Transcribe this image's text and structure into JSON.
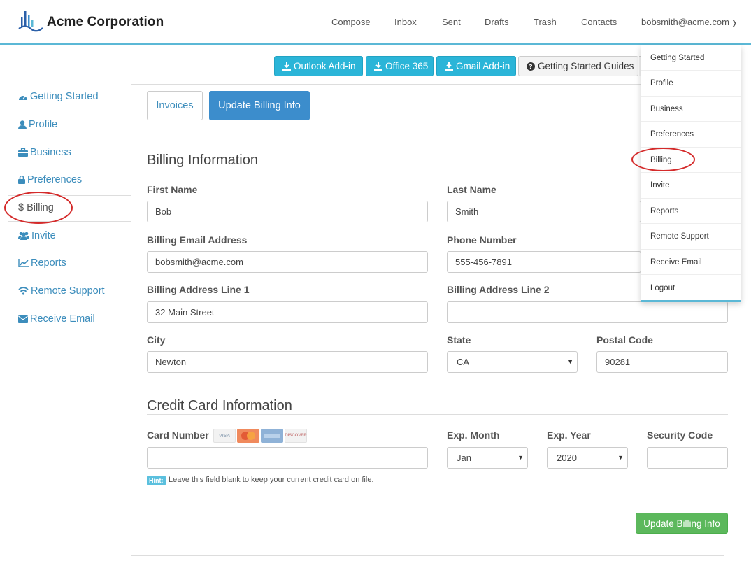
{
  "header": {
    "brand": "Acme Corporation",
    "nav": [
      "Compose",
      "Inbox",
      "Sent",
      "Drafts",
      "Trash",
      "Contacts"
    ],
    "user": "bobsmith@acme.com",
    "accent_color": "#5bb8d6"
  },
  "toolbar": {
    "outlook": "Outlook Add-in",
    "office": "Office 365",
    "gmail": "Gmail Add-in",
    "guides": "Getting Started Guides"
  },
  "sidebar": {
    "items": [
      {
        "label": "Getting Started",
        "icon": "dashboard-icon"
      },
      {
        "label": "Profile",
        "icon": "user-icon"
      },
      {
        "label": "Business",
        "icon": "briefcase-icon"
      },
      {
        "label": "Preferences",
        "icon": "lock-icon"
      },
      {
        "label": "Billing",
        "icon": "dollar-icon"
      },
      {
        "label": "Invite",
        "icon": "users-icon"
      },
      {
        "label": "Reports",
        "icon": "line-chart-icon"
      },
      {
        "label": "Remote Support",
        "icon": "wifi-icon"
      },
      {
        "label": "Receive Email",
        "icon": "envelope-icon"
      }
    ],
    "active": "Billing"
  },
  "tabs": {
    "invoices": "Invoices",
    "update": "Update Billing Info"
  },
  "billing": {
    "title": "Billing Information",
    "first_name_label": "First Name",
    "first_name": "Bob",
    "last_name_label": "Last Name",
    "last_name": "Smith",
    "email_label": "Billing Email Address",
    "email": "bobsmith@acme.com",
    "phone_label": "Phone Number",
    "phone": "555-456-7891",
    "address1_label": "Billing Address Line 1",
    "address1": "32 Main Street",
    "address2_label": "Billing Address Line 2",
    "address2": "",
    "city_label": "City",
    "city": "Newton",
    "state_label": "State",
    "state": "CA",
    "postal_label": "Postal Code",
    "postal": "90281"
  },
  "card": {
    "title": "Credit Card Information",
    "number_label": "Card Number",
    "number": "",
    "brands": [
      "VISA",
      "MasterCard",
      "AMERICAN EXPRESS",
      "DISCOVER"
    ],
    "exp_month_label": "Exp. Month",
    "exp_month": "Jan",
    "exp_year_label": "Exp. Year",
    "exp_year": "2020",
    "security_label": "Security Code",
    "security": "",
    "hint_badge": "Hint:",
    "hint": "Leave this field blank to keep your current credit card on file."
  },
  "submit": "Update Billing Info",
  "dropdown": {
    "items": [
      "Getting Started",
      "Profile",
      "Business",
      "Preferences",
      "Billing",
      "Invite",
      "Reports",
      "Remote Support",
      "Receive Email",
      "Logout"
    ]
  },
  "colors": {
    "link": "#3c8dbc",
    "primary": "#3c8dcc",
    "success": "#5cb85c",
    "info": "#2bb5d8",
    "annotation": "#d42a2a"
  }
}
